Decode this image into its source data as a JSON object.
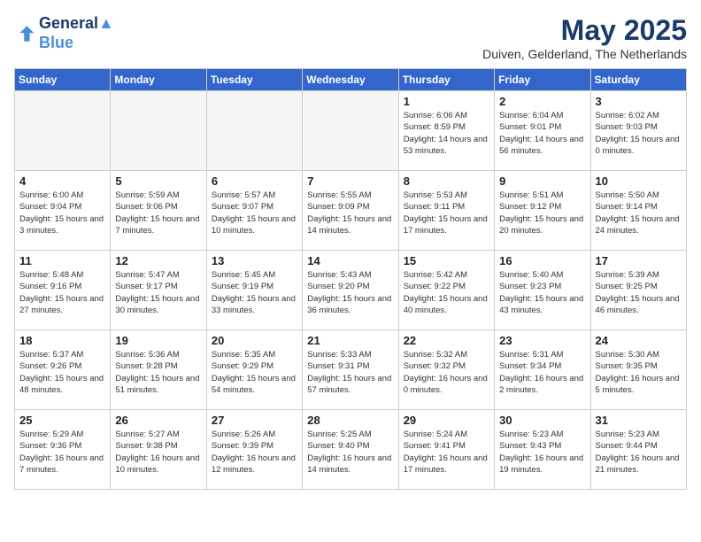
{
  "logo": {
    "line1": "General",
    "line2": "Blue"
  },
  "title": "May 2025",
  "location": "Duiven, Gelderland, The Netherlands",
  "headers": [
    "Sunday",
    "Monday",
    "Tuesday",
    "Wednesday",
    "Thursday",
    "Friday",
    "Saturday"
  ],
  "weeks": [
    [
      {
        "day": "",
        "empty": true
      },
      {
        "day": "",
        "empty": true
      },
      {
        "day": "",
        "empty": true
      },
      {
        "day": "",
        "empty": true
      },
      {
        "day": "1",
        "sunrise": "6:06 AM",
        "sunset": "8:59 PM",
        "daylight": "14 hours and 53 minutes."
      },
      {
        "day": "2",
        "sunrise": "6:04 AM",
        "sunset": "9:01 PM",
        "daylight": "14 hours and 56 minutes."
      },
      {
        "day": "3",
        "sunrise": "6:02 AM",
        "sunset": "9:03 PM",
        "daylight": "15 hours and 0 minutes."
      }
    ],
    [
      {
        "day": "4",
        "sunrise": "6:00 AM",
        "sunset": "9:04 PM",
        "daylight": "15 hours and 3 minutes."
      },
      {
        "day": "5",
        "sunrise": "5:59 AM",
        "sunset": "9:06 PM",
        "daylight": "15 hours and 7 minutes."
      },
      {
        "day": "6",
        "sunrise": "5:57 AM",
        "sunset": "9:07 PM",
        "daylight": "15 hours and 10 minutes."
      },
      {
        "day": "7",
        "sunrise": "5:55 AM",
        "sunset": "9:09 PM",
        "daylight": "15 hours and 14 minutes."
      },
      {
        "day": "8",
        "sunrise": "5:53 AM",
        "sunset": "9:11 PM",
        "daylight": "15 hours and 17 minutes."
      },
      {
        "day": "9",
        "sunrise": "5:51 AM",
        "sunset": "9:12 PM",
        "daylight": "15 hours and 20 minutes."
      },
      {
        "day": "10",
        "sunrise": "5:50 AM",
        "sunset": "9:14 PM",
        "daylight": "15 hours and 24 minutes."
      }
    ],
    [
      {
        "day": "11",
        "sunrise": "5:48 AM",
        "sunset": "9:16 PM",
        "daylight": "15 hours and 27 minutes."
      },
      {
        "day": "12",
        "sunrise": "5:47 AM",
        "sunset": "9:17 PM",
        "daylight": "15 hours and 30 minutes."
      },
      {
        "day": "13",
        "sunrise": "5:45 AM",
        "sunset": "9:19 PM",
        "daylight": "15 hours and 33 minutes."
      },
      {
        "day": "14",
        "sunrise": "5:43 AM",
        "sunset": "9:20 PM",
        "daylight": "15 hours and 36 minutes."
      },
      {
        "day": "15",
        "sunrise": "5:42 AM",
        "sunset": "9:22 PM",
        "daylight": "15 hours and 40 minutes."
      },
      {
        "day": "16",
        "sunrise": "5:40 AM",
        "sunset": "9:23 PM",
        "daylight": "15 hours and 43 minutes."
      },
      {
        "day": "17",
        "sunrise": "5:39 AM",
        "sunset": "9:25 PM",
        "daylight": "15 hours and 46 minutes."
      }
    ],
    [
      {
        "day": "18",
        "sunrise": "5:37 AM",
        "sunset": "9:26 PM",
        "daylight": "15 hours and 48 minutes."
      },
      {
        "day": "19",
        "sunrise": "5:36 AM",
        "sunset": "9:28 PM",
        "daylight": "15 hours and 51 minutes."
      },
      {
        "day": "20",
        "sunrise": "5:35 AM",
        "sunset": "9:29 PM",
        "daylight": "15 hours and 54 minutes."
      },
      {
        "day": "21",
        "sunrise": "5:33 AM",
        "sunset": "9:31 PM",
        "daylight": "15 hours and 57 minutes."
      },
      {
        "day": "22",
        "sunrise": "5:32 AM",
        "sunset": "9:32 PM",
        "daylight": "16 hours and 0 minutes."
      },
      {
        "day": "23",
        "sunrise": "5:31 AM",
        "sunset": "9:34 PM",
        "daylight": "16 hours and 2 minutes."
      },
      {
        "day": "24",
        "sunrise": "5:30 AM",
        "sunset": "9:35 PM",
        "daylight": "16 hours and 5 minutes."
      }
    ],
    [
      {
        "day": "25",
        "sunrise": "5:29 AM",
        "sunset": "9:36 PM",
        "daylight": "16 hours and 7 minutes."
      },
      {
        "day": "26",
        "sunrise": "5:27 AM",
        "sunset": "9:38 PM",
        "daylight": "16 hours and 10 minutes."
      },
      {
        "day": "27",
        "sunrise": "5:26 AM",
        "sunset": "9:39 PM",
        "daylight": "16 hours and 12 minutes."
      },
      {
        "day": "28",
        "sunrise": "5:25 AM",
        "sunset": "9:40 PM",
        "daylight": "16 hours and 14 minutes."
      },
      {
        "day": "29",
        "sunrise": "5:24 AM",
        "sunset": "9:41 PM",
        "daylight": "16 hours and 17 minutes."
      },
      {
        "day": "30",
        "sunrise": "5:23 AM",
        "sunset": "9:43 PM",
        "daylight": "16 hours and 19 minutes."
      },
      {
        "day": "31",
        "sunrise": "5:23 AM",
        "sunset": "9:44 PM",
        "daylight": "16 hours and 21 minutes."
      }
    ]
  ]
}
